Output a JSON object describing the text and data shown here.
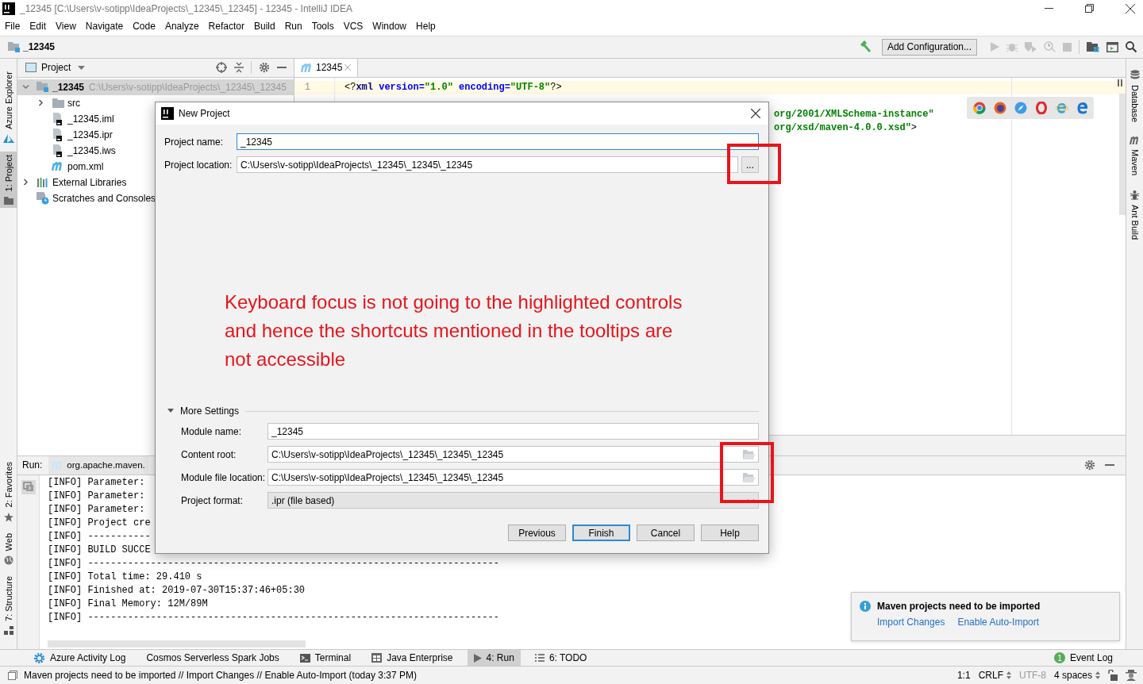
{
  "window": {
    "title": "_12345 [C:\\Users\\v-sotipp\\IdeaProjects\\_12345\\_12345] - 12345 - IntelliJ IDEA"
  },
  "menu": [
    "File",
    "Edit",
    "View",
    "Navigate",
    "Code",
    "Analyze",
    "Refactor",
    "Build",
    "Run",
    "Tools",
    "VCS",
    "Window",
    "Help"
  ],
  "navigation_bar": {
    "breadcrumb": "_12345",
    "run_configuration": "Add Configuration..."
  },
  "left_stripe": {
    "top": [
      {
        "label": "Azure Explorer",
        "kind": "azure",
        "selected": false
      },
      {
        "label": "1: Project",
        "kind": "project",
        "selected": true
      }
    ],
    "bottom": [
      {
        "label": "2: Favorites",
        "kind": "favorites",
        "selected": false
      },
      {
        "label": "Web",
        "kind": "web",
        "selected": false
      },
      {
        "label": "7: Structure",
        "kind": "structure",
        "selected": false
      }
    ]
  },
  "right_stripe": [
    {
      "label": "Database",
      "kind": "database"
    },
    {
      "label": "Maven",
      "kind": "maven"
    },
    {
      "label": "Ant Build",
      "kind": "ant"
    }
  ],
  "project_panel": {
    "title": "Project",
    "tree": [
      {
        "label": "_12345",
        "path": "C:\\Users\\v-sotipp\\IdeaProjects\\_12345\\_12345",
        "kind": "module",
        "expanded": true,
        "selected": true,
        "children": [
          {
            "label": "src",
            "kind": "folder",
            "expanded": false,
            "selected": false
          },
          {
            "label": "_12345.iml",
            "kind": "file",
            "selected": false
          },
          {
            "label": "_12345.ipr",
            "kind": "file",
            "selected": false
          },
          {
            "label": "_12345.iws",
            "kind": "file",
            "selected": false
          },
          {
            "label": "pom.xml",
            "kind": "maven",
            "selected": false
          }
        ]
      },
      {
        "label": "External Libraries",
        "kind": "libraries",
        "expanded": false,
        "selected": false
      },
      {
        "label": "Scratches and Consoles",
        "kind": "scratches",
        "selected": false
      }
    ]
  },
  "editor": {
    "tabs": [
      {
        "label": "12345",
        "selected": true
      }
    ],
    "lines": [
      {
        "kind": "line",
        "number": "1",
        "current": true,
        "tokens": [
          {
            "text": "<?",
            "kind": "plain"
          },
          {
            "text": "xml",
            "kind": "tag"
          },
          {
            "text": " version=",
            "kind": "attr"
          },
          {
            "text": "\"1.0\"",
            "kind": "string"
          },
          {
            "text": " encoding=",
            "kind": "attr"
          },
          {
            "text": "\"UTF-8\"",
            "kind": "string"
          },
          {
            "text": "?>",
            "kind": "plain"
          }
        ]
      },
      {
        "kind": "hidden",
        "current": false
      },
      {
        "kind": "fragment",
        "current": false,
        "tokens": [
          {
            "text": "org/2001/XMLSchema-instance\"",
            "kind": "string"
          }
        ]
      },
      {
        "kind": "fragment",
        "current": false,
        "tokens": [
          {
            "text": "org/xsd/maven-4.0.0.xsd\"",
            "kind": "string"
          },
          {
            "text": ">",
            "kind": "plain"
          }
        ]
      }
    ]
  },
  "run_panel": {
    "title": "Run:",
    "tabs": [
      {
        "label": "org.apache.maven.",
        "selected": true
      }
    ],
    "console": [
      "[INFO] Parameter:",
      "[INFO] Parameter:",
      "[INFO] Parameter:",
      "[INFO] Project cre",
      "[INFO] -----------",
      "[INFO] BUILD SUCCE",
      "[INFO] ------------------------------------------------------------------------",
      "[INFO] Total time: 29.410 s",
      "[INFO] Finished at: 2019-07-30T15:37:46+05:30",
      "[INFO] Final Memory: 12M/89M",
      "[INFO] ------------------------------------------------------------------------"
    ]
  },
  "notification": {
    "title": "Maven projects need to be imported",
    "actions": [
      "Import Changes",
      "Enable Auto-Import"
    ]
  },
  "tool_windows": [
    {
      "label": "Azure Activity Log",
      "kind": "azure",
      "selected": false
    },
    {
      "label": "Cosmos Serverless Spark Jobs",
      "kind": "none",
      "selected": false
    },
    {
      "label": "Terminal",
      "kind": "terminal",
      "selected": false
    },
    {
      "label": "Java Enterprise",
      "kind": "javaee",
      "selected": false
    },
    {
      "label": "4: Run",
      "kind": "run",
      "selected": true
    },
    {
      "label": "6: TODO",
      "kind": "todo",
      "selected": false
    }
  ],
  "event_log": {
    "label": "Event Log",
    "count": "1"
  },
  "status_bar": {
    "message": "Maven projects need to be imported // Import Changes // Enable Auto-Import (today 3:37 PM)",
    "items": [
      {
        "label": "1:1",
        "kind": "plain",
        "disabled": false
      },
      {
        "label": "CRLF",
        "kind": "menu",
        "disabled": false
      },
      {
        "label": "UTF-8",
        "kind": "plain",
        "disabled": true
      },
      {
        "label": "4 spaces",
        "kind": "menu",
        "disabled": false
      }
    ]
  },
  "dialog": {
    "title": "New Project",
    "fields": [
      {
        "label": "Project name:",
        "value": "_12345",
        "kind": "text",
        "focused": true
      },
      {
        "label": "Project location:",
        "value": "C:\\Users\\v-sotipp\\IdeaProjects\\_12345\\_12345\\_12345",
        "kind": "browse",
        "browse_label": "...",
        "focused": false
      }
    ],
    "annotation": "Keyboard focus is not going to the highlighted controls and hence the shortcuts mentioned in the tooltips are not accessible",
    "more_settings": {
      "label": "More Settings",
      "expanded": true,
      "fields": [
        {
          "label": "Module name:",
          "value": "_12345",
          "kind": "text",
          "focused": false
        },
        {
          "label": "Content root:",
          "value": "C:\\Users\\v-sotipp\\IdeaProjects\\_12345\\_12345\\_12345",
          "kind": "folder",
          "focused": false
        },
        {
          "label": "Module file location:",
          "value": "C:\\Users\\v-sotipp\\IdeaProjects\\_12345\\_12345\\_12345",
          "kind": "folder",
          "focused": false
        },
        {
          "label": "Project format:",
          "value": ".ipr (file based)",
          "kind": "dropdown",
          "focused": false
        }
      ]
    },
    "buttons": [
      {
        "label": "Previous",
        "default": false
      },
      {
        "label": "Finish",
        "default": true
      },
      {
        "label": "Cancel",
        "default": false
      },
      {
        "label": "Help",
        "default": false
      }
    ]
  }
}
